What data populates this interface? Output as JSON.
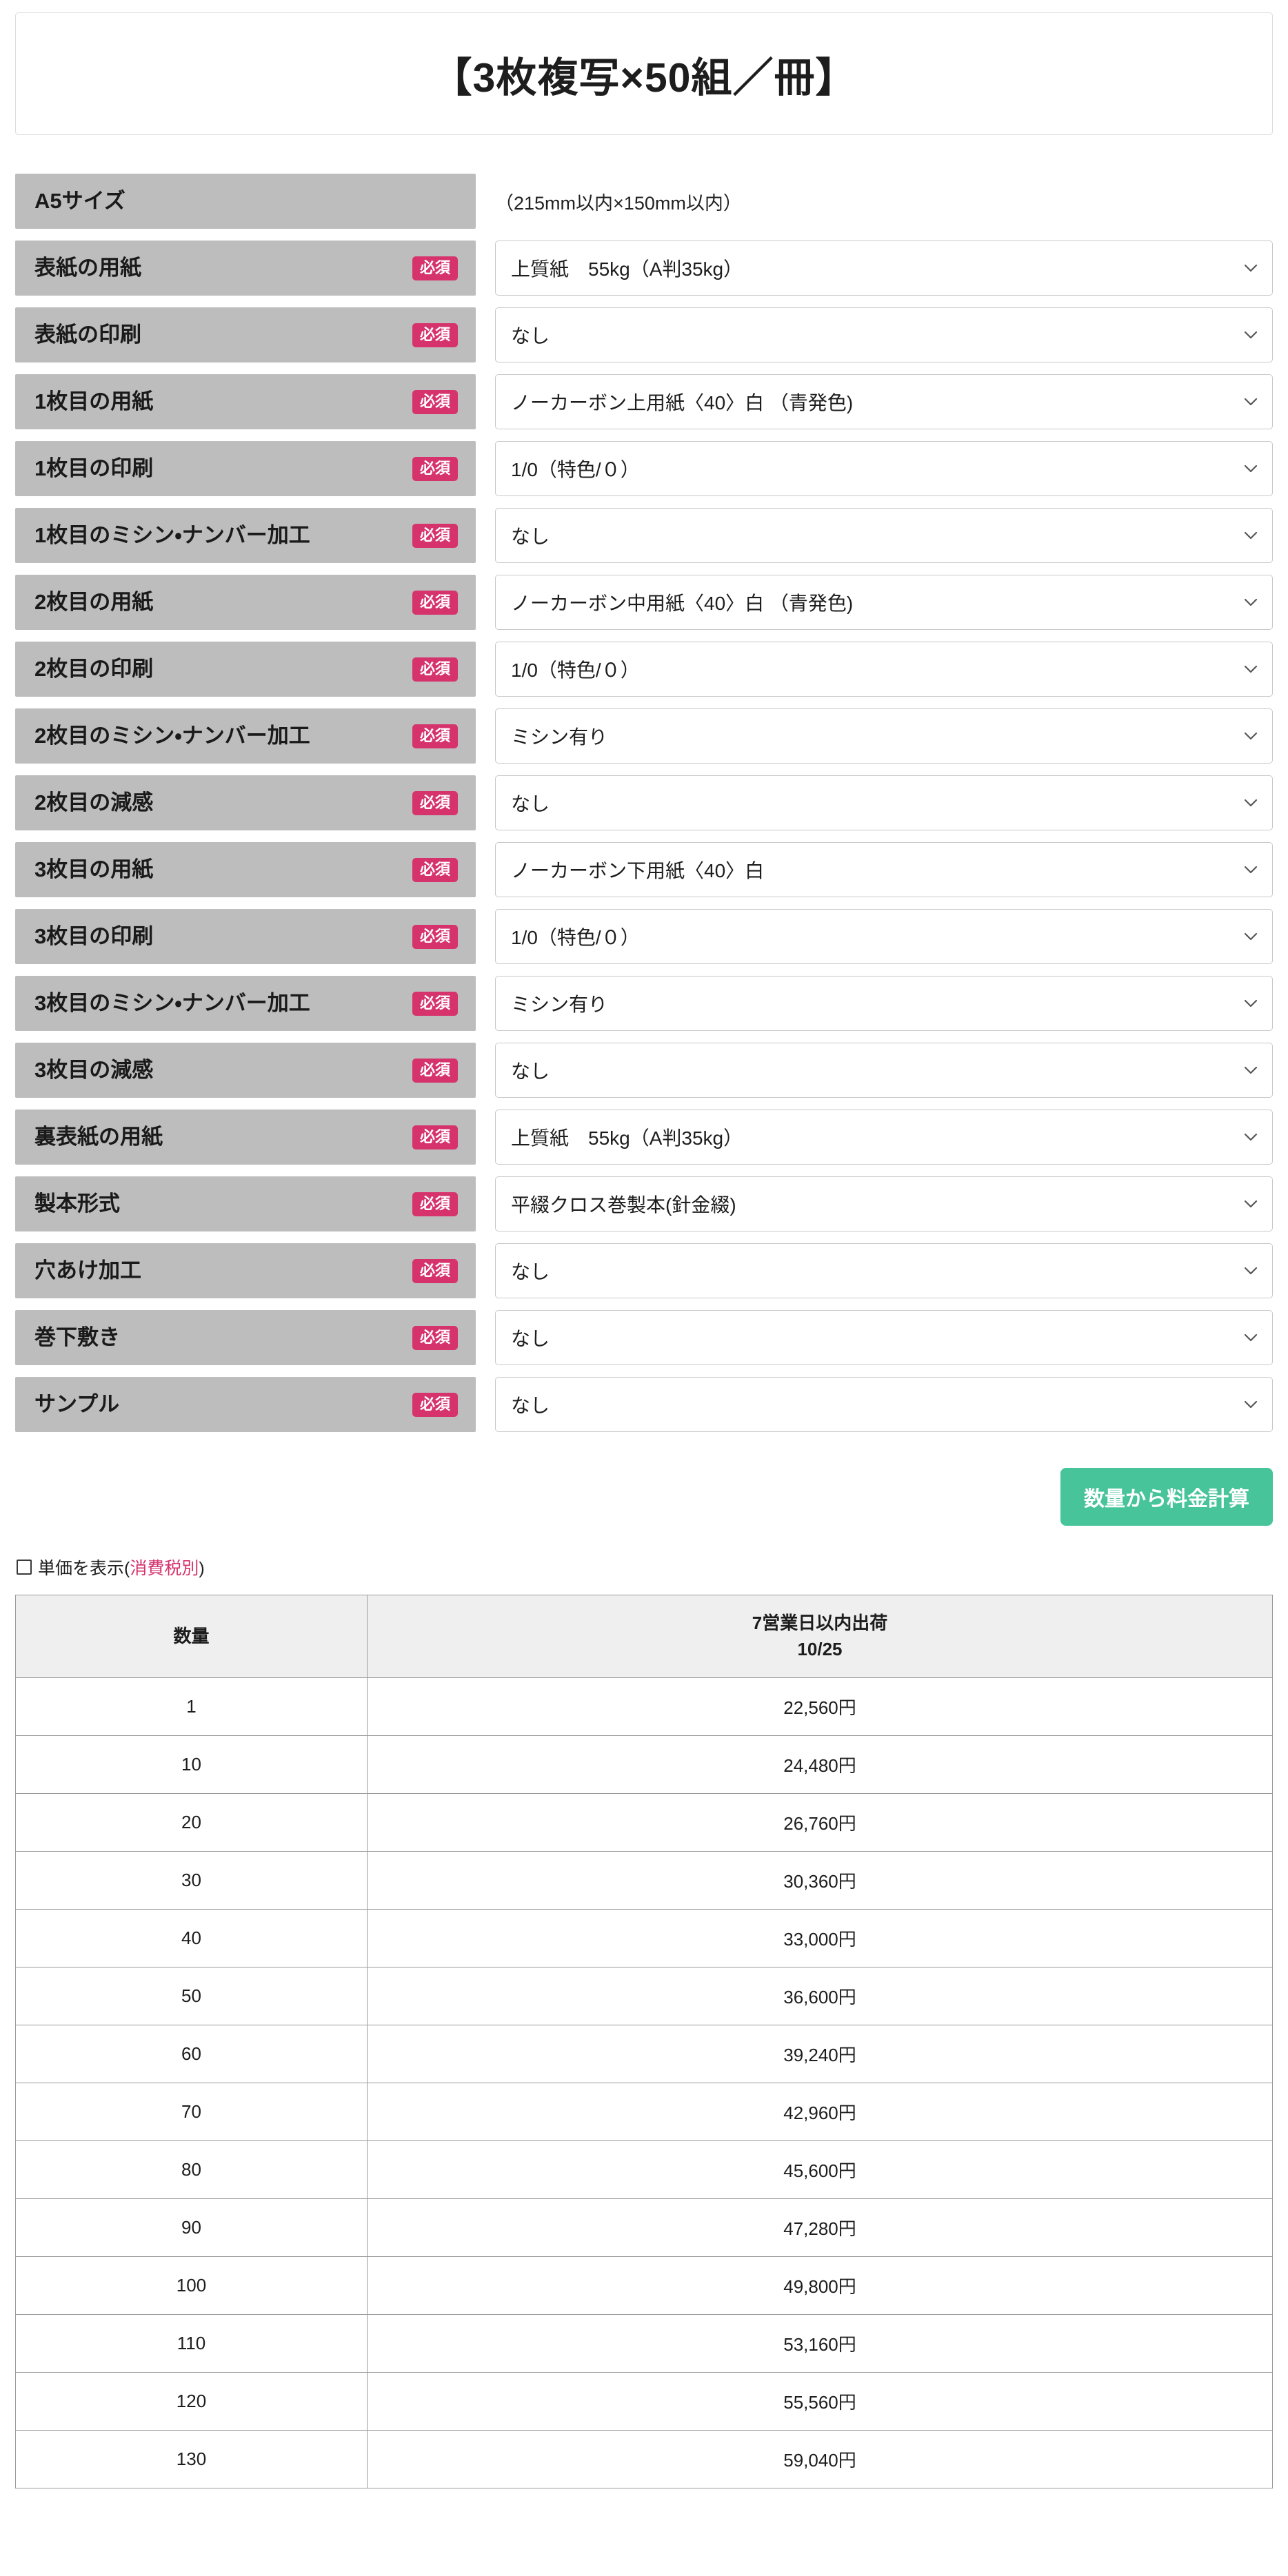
{
  "title": "【3枚複写×50組／冊】",
  "size_row": {
    "label": "A5サイズ",
    "note": "（215mm以内×150mm以内）"
  },
  "badge_required": "必須",
  "options": [
    {
      "label": "表紙の用紙",
      "value": "上質紙　55kg（A判35kg）"
    },
    {
      "label": "表紙の印刷",
      "value": "なし"
    },
    {
      "label": "1枚目の用紙",
      "value": "ノーカーボン上用紙〈40〉白 （青発色)"
    },
    {
      "label": "1枚目の印刷",
      "value": "1/0（特色/０）"
    },
    {
      "label": "1枚目のミシン・ナンバー加工",
      "value": "なし"
    },
    {
      "label": "2枚目の用紙",
      "value": "ノーカーボン中用紙〈40〉白 （青発色)"
    },
    {
      "label": "2枚目の印刷",
      "value": "1/0（特色/０）"
    },
    {
      "label": "2枚目のミシン・ナンバー加工",
      "value": "ミシン有り"
    },
    {
      "label": "2枚目の減感",
      "value": "なし"
    },
    {
      "label": "3枚目の用紙",
      "value": "ノーカーボン下用紙〈40〉白"
    },
    {
      "label": "3枚目の印刷",
      "value": "1/0（特色/０）"
    },
    {
      "label": "3枚目のミシン・ナンバー加工",
      "value": "ミシン有り"
    },
    {
      "label": "3枚目の減感",
      "value": "なし"
    },
    {
      "label": "裏表紙の用紙",
      "value": "上質紙　55kg（A判35kg）"
    },
    {
      "label": "製本形式",
      "value": "平綴クロス巻製本(針金綴)"
    },
    {
      "label": "穴あけ加工",
      "value": "なし"
    },
    {
      "label": "巻下敷き",
      "value": "なし"
    },
    {
      "label": "サンプル",
      "value": "なし"
    }
  ],
  "calc_button_label": "数量から料金計算",
  "unit_price": {
    "label_before": "単価を表示(",
    "tax_note": "消費税別",
    "label_after": ")"
  },
  "price_table": {
    "header_qty": "数量",
    "header_shipping_line1": "7営業日以内出荷",
    "header_shipping_line2": "10/25",
    "rows": [
      {
        "qty": "1",
        "price": "22,560円"
      },
      {
        "qty": "10",
        "price": "24,480円"
      },
      {
        "qty": "20",
        "price": "26,760円"
      },
      {
        "qty": "30",
        "price": "30,360円"
      },
      {
        "qty": "40",
        "price": "33,000円"
      },
      {
        "qty": "50",
        "price": "36,600円"
      },
      {
        "qty": "60",
        "price": "39,240円"
      },
      {
        "qty": "70",
        "price": "42,960円"
      },
      {
        "qty": "80",
        "price": "45,600円"
      },
      {
        "qty": "90",
        "price": "47,280円"
      },
      {
        "qty": "100",
        "price": "49,800円"
      },
      {
        "qty": "110",
        "price": "53,160円"
      },
      {
        "qty": "120",
        "price": "55,560円"
      },
      {
        "qty": "130",
        "price": "59,040円"
      }
    ]
  },
  "colors": {
    "badge": "#d6336c",
    "label_bg": "#bdbdbd",
    "button_green": "#48c49a",
    "price_blue": "#2a72c8",
    "tax_pink": "#d6336c"
  }
}
